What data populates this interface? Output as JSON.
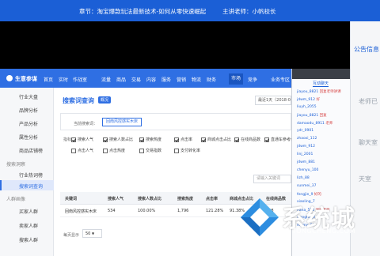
{
  "banner": {
    "chapter": "章节：淘宝爆款玩法最新技术-如何从零快速崛起",
    "host": "主讲老师：小帆校长"
  },
  "right_panel": {
    "title": "公告信息",
    "messages": [
      "老师已",
      "聊天室",
      "天室"
    ]
  },
  "app": {
    "brand": "生意参谋",
    "nav": [
      "首页",
      "实时",
      "作战室",
      "流量",
      "商品",
      "交易",
      "内容",
      "服务",
      "营销",
      "物流",
      "财务",
      "市场",
      "竞争"
    ],
    "nav_active": "市场",
    "right_item": "业务专区"
  },
  "sidebar": {
    "items": [
      {
        "label": "行业大盘",
        "type": "item"
      },
      {
        "label": "品牌分析",
        "type": "item"
      },
      {
        "label": "产品分析",
        "type": "item"
      },
      {
        "label": "属性分析",
        "type": "item"
      },
      {
        "label": "商品店铺榜",
        "type": "item"
      },
      {
        "label": "搜索洞察",
        "type": "group"
      },
      {
        "label": "行业热词榜",
        "type": "item"
      },
      {
        "label": "搜索词查询",
        "type": "item",
        "active": true
      },
      {
        "label": "人群画像",
        "type": "group"
      },
      {
        "label": "买家人群",
        "type": "item"
      },
      {
        "label": "卖家人群",
        "type": "item"
      },
      {
        "label": "搜索人群",
        "type": "item"
      }
    ]
  },
  "content": {
    "title": "搜索词查询",
    "badge": "概况",
    "date_range": "最近1天（2018-06-20）",
    "search_label": "当前搜索词：",
    "search_term": "回南风控感实木床",
    "filter_lead": "指标",
    "filters_row1": [
      {
        "label": "搜索人气",
        "checked": true
      },
      {
        "label": "搜索人数占比",
        "checked": true
      },
      {
        "label": "搜索热度",
        "checked": true
      },
      {
        "label": "点击率",
        "checked": true
      },
      {
        "label": "商城点击占比",
        "checked": true
      },
      {
        "label": "在线商品数",
        "checked": true
      },
      {
        "label": "直通车参考价",
        "checked": true
      }
    ],
    "filters_row2": [
      {
        "label": "点击人气",
        "checked": false
      },
      {
        "label": "点击热度",
        "checked": false
      },
      {
        "label": "交易指数",
        "checked": false
      },
      {
        "label": "支付转化率",
        "checked": false
      }
    ],
    "keyword_search_placeholder": "请输入关键词",
    "table": {
      "headers": [
        "关键词",
        "搜索人气",
        "搜索人数占比",
        "搜索热度",
        "点击率",
        "商城点击占比",
        "在线商品数"
      ],
      "rows": [
        [
          "回南风控感实木床",
          "534",
          "100.00%",
          "1,796",
          "121.28%",
          "91.38%",
          "808"
        ]
      ]
    },
    "pager_label": "每页显示",
    "pager_value": "50"
  },
  "chat": {
    "tab": "互动聊天",
    "messages": [
      {
        "user": "jiayou_8821",
        "text": "回复老师讲课"
      },
      {
        "user": "jdwm_912",
        "text": "好"
      },
      {
        "user": "liuyh_2055",
        "text": ""
      },
      {
        "user": "jiayou_8821",
        "text": "回复"
      },
      {
        "user": "damaodu_8911",
        "text": "老师"
      },
      {
        "user": "ydr_0901",
        "text": ""
      },
      {
        "user": "zhaoxi_112",
        "text": ""
      },
      {
        "user": "jdwm_912",
        "text": ""
      },
      {
        "user": "linj_2001",
        "text": ""
      },
      {
        "user": "jdwm_881",
        "text": ""
      },
      {
        "user": "chenyu_100",
        "text": ""
      },
      {
        "user": "lizh_88",
        "text": ""
      },
      {
        "user": "sunmei_37",
        "text": ""
      },
      {
        "user": "fengjie_9",
        "text": "好的"
      },
      {
        "user": "xiaoling_7",
        "text": ""
      },
      {
        "user": "nana_520",
        "text": "谢谢老师"
      },
      {
        "user": "wangfei_3",
        "text": ""
      },
      {
        "user": "mumu_66",
        "text": ""
      }
    ]
  },
  "watermark": {
    "title": "系统城",
    "subtitle": "XITONGCHENG.COM"
  },
  "colors": {
    "banner": "#1b5fd6",
    "app_header": "#2f6fe3",
    "accent": "#2f6fe3"
  }
}
